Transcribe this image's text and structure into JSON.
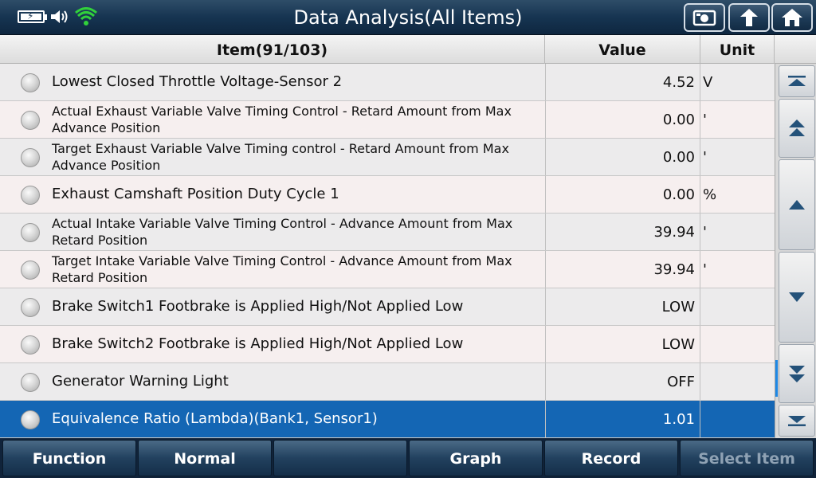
{
  "header": {
    "title": "Data Analysis(All Items)",
    "buttons": [
      "screenshot-icon",
      "back-icon",
      "home-icon"
    ]
  },
  "status": {
    "icons": [
      "battery-icon",
      "speaker-icon",
      "wifi-icon"
    ]
  },
  "table": {
    "columns": {
      "item": "Item(91/103)",
      "value": "Value",
      "unit": "Unit"
    },
    "rows": [
      {
        "item": "Lowest Closed Throttle Voltage-Sensor 2",
        "value": "4.52",
        "unit": "V"
      },
      {
        "item": "Actual Exhaust Variable Valve Timing Control - Retard Amount from Max Advance Position",
        "value": "0.00",
        "unit": "'"
      },
      {
        "item": "Target Exhaust Variable Valve Timing control - Retard Amount from Max Advance Position",
        "value": "0.00",
        "unit": "'"
      },
      {
        "item": "Exhaust Camshaft Position Duty Cycle 1",
        "value": "0.00",
        "unit": "%"
      },
      {
        "item": "Actual Intake Variable Valve Timing Control - Advance Amount from Max Retard Position",
        "value": "39.94",
        "unit": "'"
      },
      {
        "item": "Target Intake Variable Valve Timing Control - Advance Amount from Max Retard Position",
        "value": "39.94",
        "unit": "'"
      },
      {
        "item": "Brake Switch1 Footbrake is Applied High/Not Applied Low",
        "value": "LOW",
        "unit": ""
      },
      {
        "item": "Brake Switch2 Footbrake is Applied High/Not Applied Low",
        "value": "LOW",
        "unit": ""
      },
      {
        "item": "Generator Warning Light",
        "value": "OFF",
        "unit": ""
      },
      {
        "item": "Equivalence Ratio (Lambda)(Bank1, Sensor1)",
        "value": "1.01",
        "unit": ""
      }
    ],
    "selected_row": 9
  },
  "scroll_buttons": [
    "scroll-top-icon",
    "page-up-icon",
    "line-up-icon",
    "line-down-icon",
    "page-down-icon",
    "scroll-bottom-icon"
  ],
  "footer": {
    "buttons": [
      {
        "label": "Function",
        "enabled": true
      },
      {
        "label": "Normal",
        "enabled": true
      },
      {
        "label": "",
        "enabled": true
      },
      {
        "label": "Graph",
        "enabled": true
      },
      {
        "label": "Record",
        "enabled": true
      },
      {
        "label": "Select Item",
        "enabled": false
      }
    ]
  },
  "colors": {
    "selected_row": "#1466b4",
    "title_bar": "#163451",
    "wifi": "#31d13b"
  }
}
